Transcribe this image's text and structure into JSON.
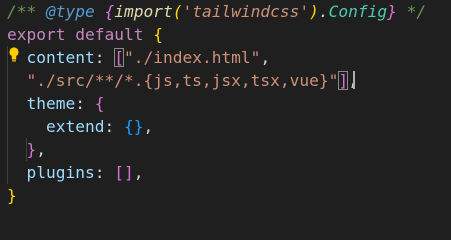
{
  "editor": {
    "lines": [
      {
        "tokens": [
          {
            "cls": "cm",
            "text": "/** "
          },
          {
            "cls": "cm-kw",
            "text": "@type"
          },
          {
            "cls": "cm",
            "text": " "
          },
          {
            "cls": "cm-br",
            "text": "{"
          },
          {
            "cls": "cm-fn",
            "text": "import"
          },
          {
            "cls": "cm-pr",
            "text": "("
          },
          {
            "cls": "cm-str",
            "text": "'tailwindcss'"
          },
          {
            "cls": "cm-pr",
            "text": ")"
          },
          {
            "cls": "cm-pl",
            "text": "."
          },
          {
            "cls": "cm-tl",
            "text": "Config"
          },
          {
            "cls": "cm-br",
            "text": "}"
          },
          {
            "cls": "cm",
            "text": " */"
          }
        ]
      },
      {
        "tokens": [
          {
            "cls": "kw",
            "text": "export"
          },
          {
            "cls": "p",
            "text": " "
          },
          {
            "cls": "kw",
            "text": "default"
          },
          {
            "cls": "p",
            "text": " "
          },
          {
            "cls": "b1",
            "text": "{"
          }
        ]
      },
      {
        "tokens": [
          {
            "cls": "p",
            "text": "  "
          },
          {
            "cls": "prop",
            "text": "content"
          },
          {
            "cls": "p",
            "text": ": "
          },
          {
            "cls": "b2 bm",
            "text": "["
          },
          {
            "cls": "str",
            "text": "\"./index.html\""
          },
          {
            "cls": "p",
            "text": ","
          }
        ]
      },
      {
        "tokens": [
          {
            "cls": "p",
            "text": "  "
          },
          {
            "cls": "str",
            "text": "\"./src/**/*.{js,ts,jsx,tsx,vue}\""
          },
          {
            "cls": "b2 bm",
            "text": "]"
          },
          {
            "cls": "p",
            "text": ","
          }
        ]
      },
      {
        "tokens": [
          {
            "cls": "p",
            "text": "  "
          },
          {
            "cls": "prop",
            "text": "theme"
          },
          {
            "cls": "p",
            "text": ": "
          },
          {
            "cls": "b2",
            "text": "{"
          }
        ]
      },
      {
        "tokens": [
          {
            "cls": "p",
            "text": "    "
          },
          {
            "cls": "prop",
            "text": "extend"
          },
          {
            "cls": "p",
            "text": ": "
          },
          {
            "cls": "b3",
            "text": "{}"
          },
          {
            "cls": "p",
            "text": ","
          }
        ]
      },
      {
        "tokens": [
          {
            "cls": "p",
            "text": "  "
          },
          {
            "cls": "b2",
            "text": "}"
          },
          {
            "cls": "p",
            "text": ","
          }
        ]
      },
      {
        "tokens": [
          {
            "cls": "p",
            "text": "  "
          },
          {
            "cls": "prop",
            "text": "plugins"
          },
          {
            "cls": "p",
            "text": ": "
          },
          {
            "cls": "b2",
            "text": "[]"
          },
          {
            "cls": "p",
            "text": ","
          }
        ]
      },
      {
        "tokens": [
          {
            "cls": "b1",
            "text": "}"
          }
        ]
      }
    ]
  },
  "colors": {
    "background": "#1f1f1f",
    "comment": "#6a9955",
    "keyword": "#c586c0",
    "property": "#9cdcfe",
    "string": "#ce9178",
    "bracket_level1": "#ffd700",
    "bracket_level2": "#da70d6",
    "bracket_level3": "#179fff",
    "lightbulb": "#ffcc00"
  },
  "icons": {
    "lightbulb": "lightbulb-icon"
  }
}
